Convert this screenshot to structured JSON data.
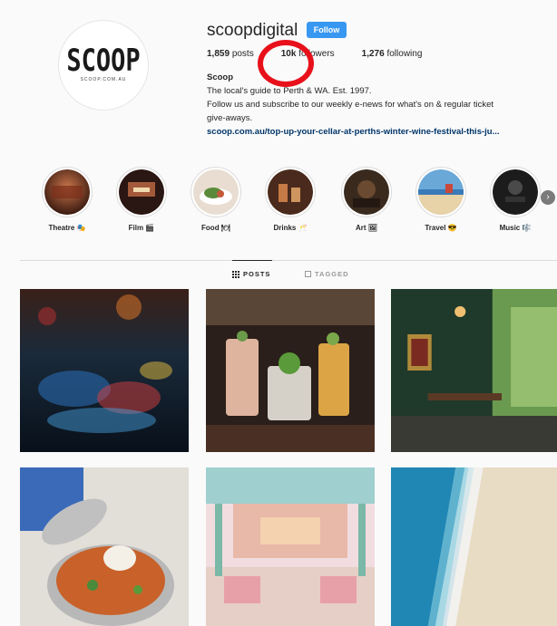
{
  "profile": {
    "logo_text": "SCOOP",
    "logo_subtext": "SCOOP.COM.AU",
    "username": "scoopdigital",
    "follow_label": "Follow",
    "posts_count": "1,859",
    "posts_label": "posts",
    "followers_count": "10k",
    "followers_label": "followers",
    "following_count": "1,276",
    "following_label": "following",
    "bio_name": "Scoop",
    "bio_line1": "The local's guide to Perth & WA. Est. 1997.",
    "bio_line2": "Follow us and subscribe to our weekly e-news for what's on & regular ticket",
    "bio_line3": "give-aways.",
    "bio_link": "scoop.com.au/top-up-your-cellar-at-perths-winter-wine-festival-this-ju..."
  },
  "highlights": [
    {
      "label": "Theatre 🎭"
    },
    {
      "label": "Film 🎬"
    },
    {
      "label": "Food 🍽"
    },
    {
      "label": "Drinks 🥂"
    },
    {
      "label": "Art 🖼"
    },
    {
      "label": "Travel 😎"
    },
    {
      "label": "Music 🎼"
    }
  ],
  "tabs": {
    "posts_label": "POSTS",
    "tagged_label": "TAGGED"
  },
  "colors": {
    "follow_button": "#3897f0",
    "annotation_circle": "#e8101a",
    "link": "#003569"
  }
}
